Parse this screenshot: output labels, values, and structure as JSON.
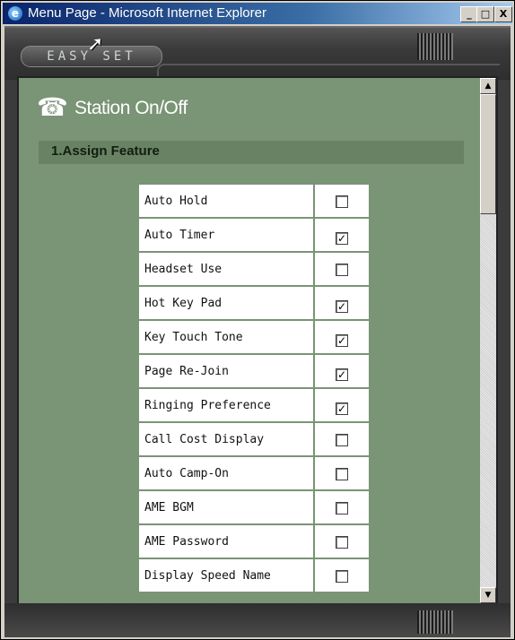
{
  "window": {
    "title": "Menu Page - Microsoft Internet Explorer",
    "controls": {
      "minimize": "_",
      "maximize": "□",
      "close": "X"
    }
  },
  "brand": {
    "logo_text": "EASY SET"
  },
  "page": {
    "title": "Station On/Off",
    "section_title": "1.Assign Feature"
  },
  "features": [
    {
      "label": "Auto Hold",
      "checked": false
    },
    {
      "label": "Auto Timer",
      "checked": true
    },
    {
      "label": "Headset Use",
      "checked": false
    },
    {
      "label": "Hot Key Pad",
      "checked": true
    },
    {
      "label": "Key Touch Tone",
      "checked": true
    },
    {
      "label": "Page Re-Join",
      "checked": true
    },
    {
      "label": "Ringing Preference",
      "checked": true
    },
    {
      "label": "Call Cost Display",
      "checked": false
    },
    {
      "label": "Auto Camp-On",
      "checked": false
    },
    {
      "label": "AME BGM",
      "checked": false
    },
    {
      "label": "AME Password",
      "checked": false
    },
    {
      "label": "Display Speed Name",
      "checked": false
    }
  ],
  "icons": {
    "window": "ie-icon",
    "page": "telephone-icon",
    "cursor": "mouse-pointer-icon"
  },
  "colors": {
    "content_bg": "#7a9476",
    "section_bar": "#6a8264",
    "frame": "#3b3b3b"
  }
}
